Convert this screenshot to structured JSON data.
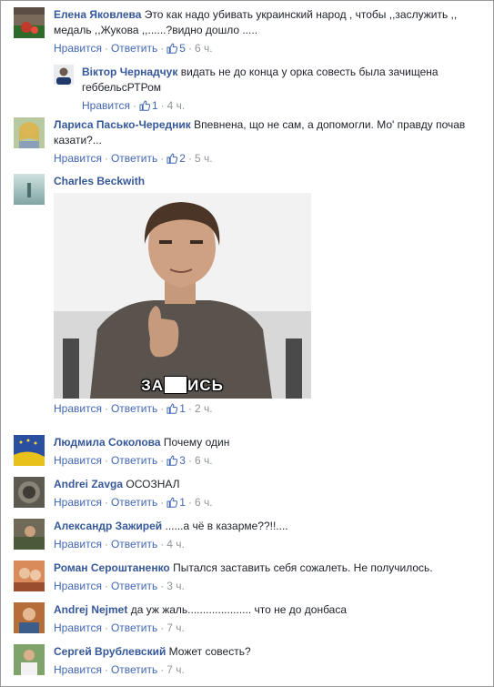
{
  "common": {
    "like": "Нравится",
    "reply": "Ответить",
    "dot": "·"
  },
  "comments": [
    {
      "name": "Елена Яковлева",
      "text": "Это как надо убивать украинский народ , чтобы ,,заслужить ,, медаль ,,Жукова ,,......?видно дошло .....",
      "likes": "5",
      "time": "6 ч."
    },
    {
      "name": "Віктор Чернадчук",
      "text": "видать не до конца у орка совесть была зачищена геббельсРТРом",
      "likes": "1",
      "time": "4 ч."
    },
    {
      "name": "Лариса Пасько-Чередник",
      "text": "Впевнена, що не сам, а допомогли. Мо' правду почав казати?...",
      "likes": "2",
      "time": "5 ч."
    },
    {
      "name": "Charles Beckwith",
      "text": "",
      "likes": "1",
      "time": "2 ч.",
      "image_caption_left": "ЗА",
      "image_caption_right": "ИСЬ"
    },
    {
      "name": "Людмила Соколова",
      "text": "Почему один",
      "likes": "3",
      "time": "6 ч."
    },
    {
      "name": "Andrei Zavga",
      "text": "ОСОЗНАЛ",
      "likes": "1",
      "time": "6 ч."
    },
    {
      "name": "Александр Зажирей",
      "text": "......а чё в казарме??!!....",
      "likes": "",
      "time": "4 ч."
    },
    {
      "name": "Роман Сероштаненко",
      "text": "Пытался заставить себя сожалеть. Не получилось.",
      "likes": "",
      "time": "3 ч."
    },
    {
      "name": "Andrej Nejmet",
      "text": "да уж жаль..................... что не до донбаса",
      "likes": "",
      "time": "7 ч."
    },
    {
      "name": "Сергей Врублевский",
      "text": "Может совесть?",
      "likes": "",
      "time": "7 ч."
    }
  ],
  "colors": {
    "name": "#365899",
    "action": "#4267b2",
    "meta": "#90949c",
    "text": "#1d2129"
  },
  "icons": {
    "like": "thumbs-up-icon"
  }
}
